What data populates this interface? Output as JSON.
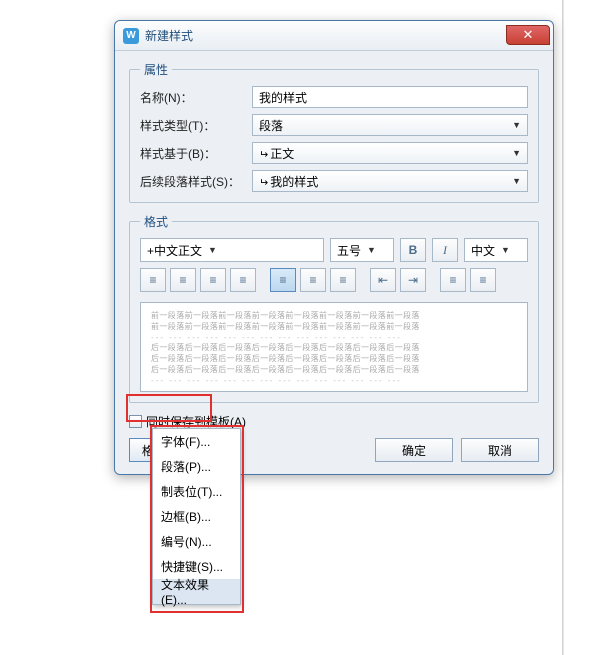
{
  "dialog": {
    "title": "新建样式",
    "close_glyph": "✕",
    "app_icon_text": "W"
  },
  "properties": {
    "legend": "属性",
    "name_label": "名称(N)：",
    "name_value": "我的样式",
    "type_label": "样式类型(T)：",
    "type_value": "段落",
    "based_on_label": "样式基于(B)：",
    "based_on_value": "正文",
    "following_label": "后续段落样式(S)：",
    "following_value": "我的样式"
  },
  "format": {
    "legend": "格式",
    "font_combo": "+中文正文",
    "size_combo": "五号",
    "lang_combo": "中文",
    "bold_label": "B",
    "italic_label": "I",
    "preview_prev": "前一段落前一段落前一段落前一段落前一段落前一段落前一段落前一段落",
    "preview_dashes": "--- --- --- --- --- --- --- --- --- --- --- --- --- ---",
    "preview_next": "后一段落后一段落后一段落后一段落后一段落后一段落后一段落后一段落"
  },
  "save_template_label": "同时保存到模板(A)",
  "format_button": "格式(O)",
  "ok_label": "确定",
  "cancel_label": "取消",
  "menu": {
    "items": [
      {
        "label": "字体(F)..."
      },
      {
        "label": "段落(P)..."
      },
      {
        "label": "制表位(T)..."
      },
      {
        "label": "边框(B)..."
      },
      {
        "label": "编号(N)..."
      },
      {
        "label": "快捷键(S)..."
      },
      {
        "label": "文本效果(E)..."
      }
    ],
    "hover_index": 6
  }
}
